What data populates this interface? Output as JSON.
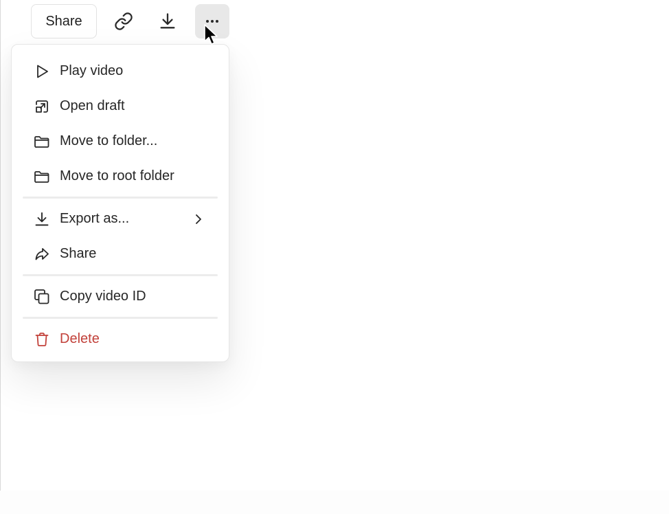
{
  "toolbar": {
    "share_label": "Share",
    "link_icon": "link-icon",
    "download_icon": "download-icon",
    "more_icon": "more-horizontal-icon"
  },
  "menu": {
    "items": [
      {
        "label": "Play video",
        "icon": "play-icon"
      },
      {
        "label": "Open draft",
        "icon": "open-draft-icon"
      },
      {
        "label": "Move to folder...",
        "icon": "folder-icon"
      },
      {
        "label": "Move to root folder",
        "icon": "folder-icon"
      },
      {
        "label": "Export as...",
        "icon": "download-icon",
        "submenu_icon": "chevron-right-icon"
      },
      {
        "label": "Share",
        "icon": "share-icon"
      },
      {
        "label": "Copy video ID",
        "icon": "copy-icon"
      },
      {
        "label": "Delete",
        "icon": "trash-icon"
      }
    ],
    "danger_color": "#c2413a"
  }
}
